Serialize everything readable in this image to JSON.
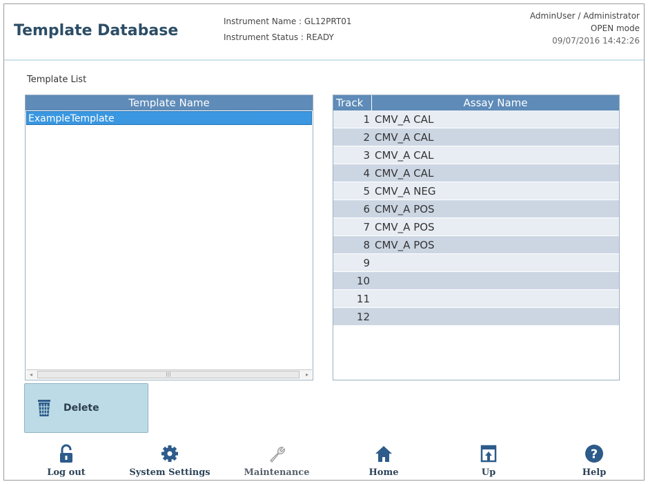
{
  "header": {
    "title": "Template Database",
    "instrument_name": "Instrument Name : GL12PRT01",
    "instrument_status": "Instrument Status : READY",
    "user": "AdminUser / Administrator",
    "mode": "OPEN mode",
    "datetime": "09/07/2016 14:42:26"
  },
  "template_list": {
    "section_label": "Template List",
    "column_header": "Template Name",
    "items": [
      "ExampleTemplate"
    ],
    "selected_index": 0
  },
  "assay_table": {
    "columns": [
      "Track",
      "Assay Name"
    ],
    "rows": [
      {
        "track": "1",
        "assay": "CMV_A CAL"
      },
      {
        "track": "2",
        "assay": "CMV_A CAL"
      },
      {
        "track": "3",
        "assay": "CMV_A CAL"
      },
      {
        "track": "4",
        "assay": "CMV_A CAL"
      },
      {
        "track": "5",
        "assay": "CMV_A NEG"
      },
      {
        "track": "6",
        "assay": "CMV_A POS"
      },
      {
        "track": "7",
        "assay": "CMV_A POS"
      },
      {
        "track": "8",
        "assay": "CMV_A POS"
      },
      {
        "track": "9",
        "assay": ""
      },
      {
        "track": "10",
        "assay": ""
      },
      {
        "track": "11",
        "assay": ""
      },
      {
        "track": "12",
        "assay": ""
      }
    ]
  },
  "actions": {
    "delete_label": "Delete"
  },
  "footer": {
    "logout": "Log out",
    "system_settings": "System Settings",
    "maintenance": "Maintenance",
    "home": "Home",
    "up": "Up",
    "help": "Help"
  },
  "colors": {
    "header_blue": "#5e8bb8",
    "selection_blue": "#3a97e0",
    "title": "#2c4d66",
    "button_bg": "#bcdbe6",
    "icon_blue": "#2d5b8a"
  }
}
